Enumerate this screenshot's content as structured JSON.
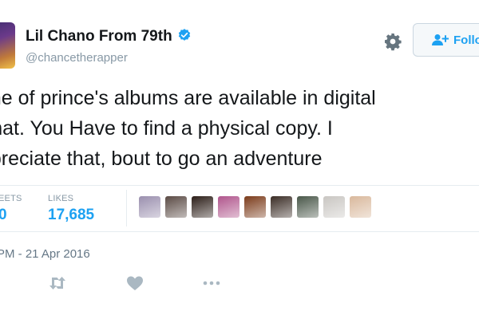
{
  "profile": {
    "name": "Lil Chano From 79th",
    "handle": "@chancetherapper",
    "verified": true
  },
  "header": {
    "follow_label": "Follo",
    "settings_icon": "gear-icon",
    "follow_icon": "add-user-icon"
  },
  "tweet": {
    "lines": [
      "one of prince's albums are available in digital",
      "rmat. You Have to find a physical copy. I",
      "ppreciate that, bout to go an adventure"
    ]
  },
  "stats": {
    "retweets_label": "EETS",
    "retweets_value": "0",
    "likes_label": "LIKES",
    "likes_value": "17,685"
  },
  "likers": [
    {
      "name": "liker-avatar-1",
      "color": "#9a8fae"
    },
    {
      "name": "liker-avatar-2",
      "color": "#5a4a44"
    },
    {
      "name": "liker-avatar-3",
      "color": "#2b1d17"
    },
    {
      "name": "liker-avatar-4",
      "color": "#b0558c"
    },
    {
      "name": "liker-avatar-5",
      "color": "#7b3b1a"
    },
    {
      "name": "liker-avatar-6",
      "color": "#3a2c25"
    },
    {
      "name": "liker-avatar-7",
      "color": "#495749"
    },
    {
      "name": "liker-avatar-8",
      "color": "#c9c6c2"
    },
    {
      "name": "liker-avatar-9",
      "color": "#d9b89c"
    }
  ],
  "timestamp": "PM - 21 Apr 2016",
  "actions": [
    "retweet-icon",
    "heart-icon",
    "more-icon"
  ],
  "colors": {
    "accent": "#1da1f2",
    "muted": "#8899a6",
    "text": "#14171a",
    "icon": "#aab8c2"
  }
}
